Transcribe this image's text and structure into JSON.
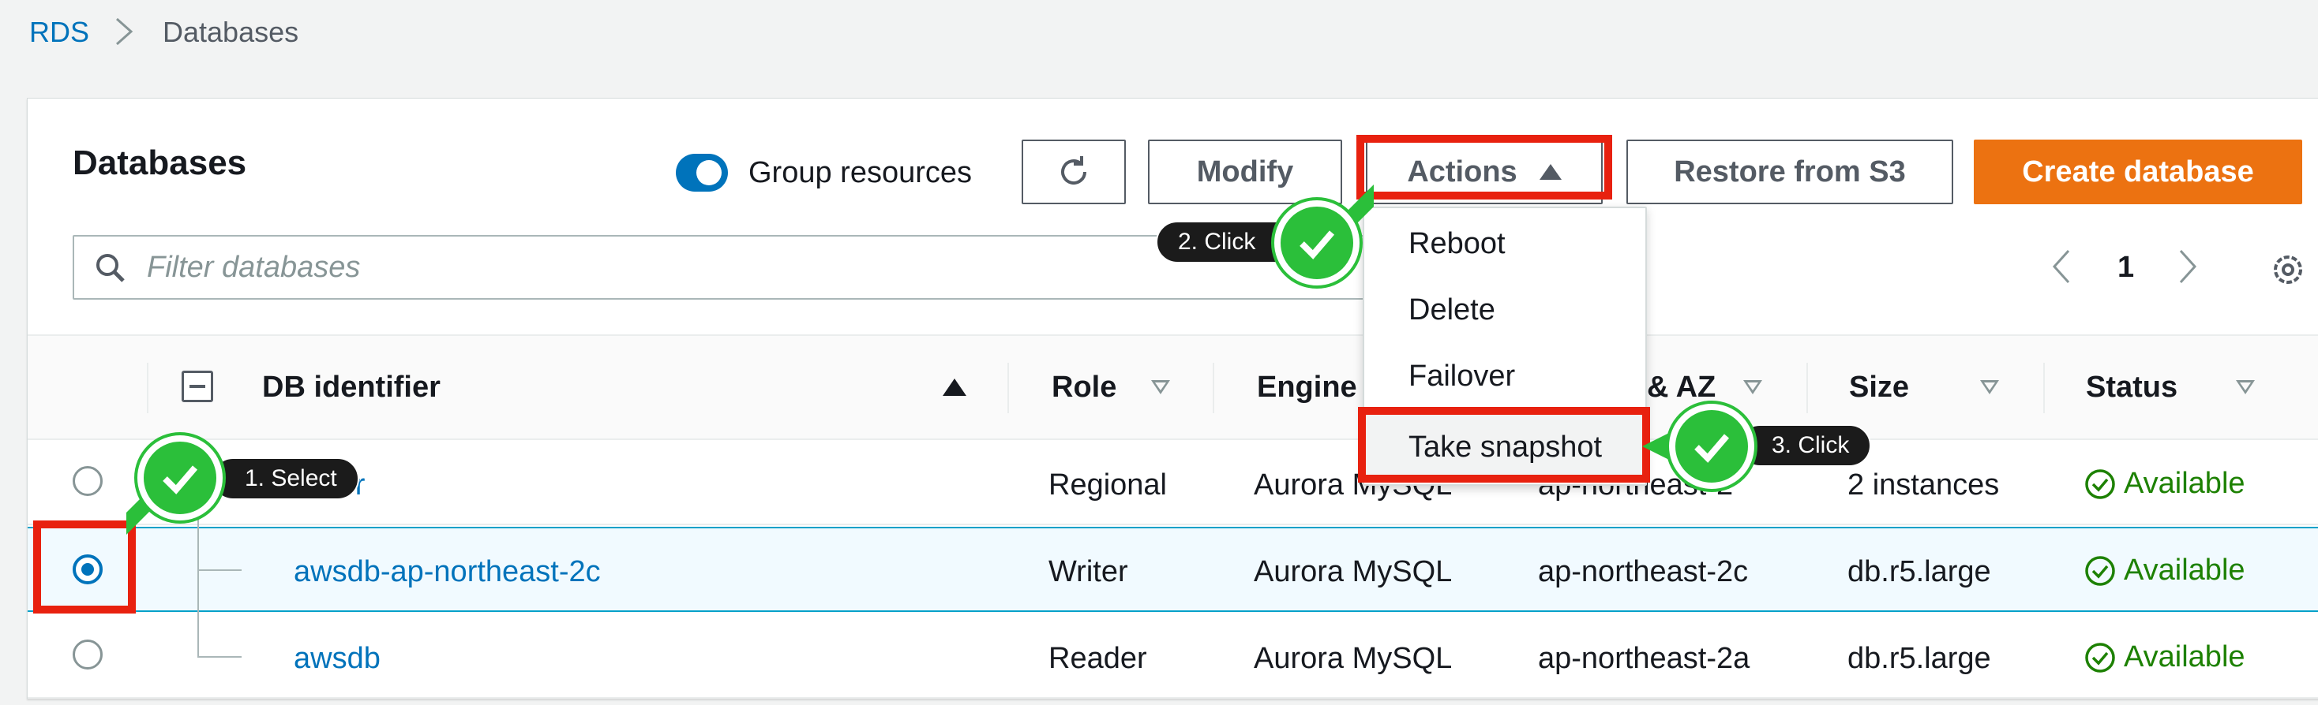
{
  "breadcrumb": {
    "root": "RDS",
    "current": "Databases"
  },
  "panel": {
    "title": "Databases",
    "group_toggle_label": "Group resources",
    "buttons": {
      "modify": "Modify",
      "actions": "Actions",
      "restore": "Restore from S3",
      "create": "Create database"
    },
    "filter_placeholder": "Filter databases",
    "page": "1"
  },
  "actions_menu": {
    "items": [
      "Reboot",
      "Delete",
      "Failover",
      "Take snapshot"
    ]
  },
  "table": {
    "headers": {
      "id": "DB identifier",
      "role": "Role",
      "engine": "Engine",
      "region": "& AZ",
      "size": "Size",
      "status": "Status"
    },
    "rows": [
      {
        "id": "ter",
        "role": "Regional",
        "engine": "Aurora MySQL",
        "region": "ap-northeast-2",
        "size": "2 instances",
        "status": "Available"
      },
      {
        "id": "awsdb-ap-northeast-2c",
        "role": "Writer",
        "engine": "Aurora MySQL",
        "region": "ap-northeast-2c",
        "size": "db.r5.large",
        "status": "Available"
      },
      {
        "id": "awsdb",
        "role": "Reader",
        "engine": "Aurora MySQL",
        "region": "ap-northeast-2a",
        "size": "db.r5.large",
        "status": "Available"
      }
    ]
  },
  "callouts": {
    "select": "1. Select",
    "click_actions": "2. Click",
    "click_snapshot": "3. Click"
  },
  "colors": {
    "link": "#0073bb",
    "primary": "#ec7211",
    "highlight": "#e8210f",
    "success": "#1d8102",
    "badge_green": "#2bbf3a"
  },
  "icons": [
    "chevron-right-icon",
    "refresh-icon",
    "caret-up-icon",
    "search-icon",
    "chevron-left-icon",
    "gear-icon",
    "check-circle-icon",
    "checkmark-icon"
  ]
}
